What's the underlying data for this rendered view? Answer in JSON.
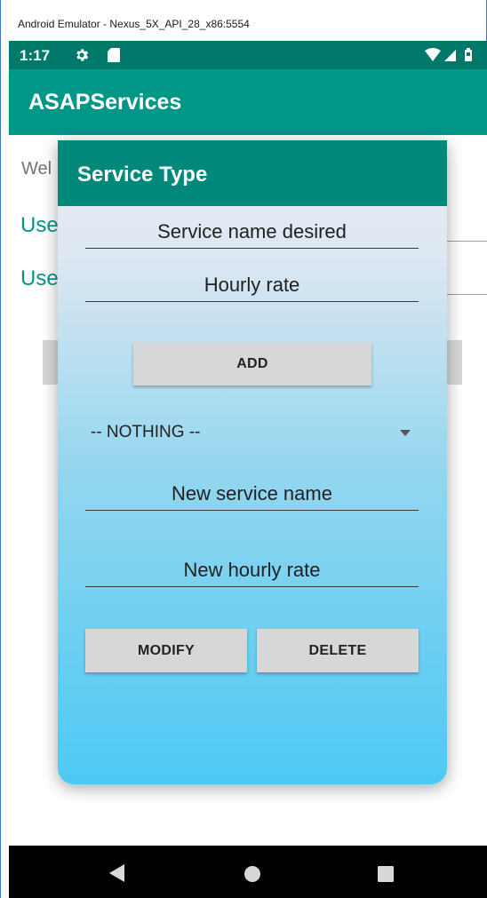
{
  "window": {
    "title": "Android Emulator - Nexus_5X_API_28_x86:5554"
  },
  "status_bar": {
    "time": "1:17",
    "icons": [
      "gear-icon",
      "sd-card-icon",
      "wifi-icon",
      "signal-icon",
      "battery-icon"
    ]
  },
  "app_bar": {
    "title": "ASAPServices"
  },
  "background": {
    "welcome_text": "Wel",
    "user_field_1": "Use",
    "user_field_2": "Use"
  },
  "dialog": {
    "title": "Service Type",
    "service_name_placeholder": "Service name desired",
    "hourly_rate_placeholder": "Hourly rate",
    "add_label": "ADD",
    "spinner_value": "-- NOTHING --",
    "new_service_name_placeholder": "New service name",
    "new_hourly_rate_placeholder": "New hourly rate",
    "modify_label": "MODIFY",
    "delete_label": "DELETE"
  },
  "colors": {
    "status_bar": "#00796b",
    "app_bar": "#009688",
    "dialog_header": "#00897b",
    "accent_text": "#009688",
    "button": "#d6d7d7"
  },
  "nav_bar": {
    "icons": [
      "back-icon",
      "home-icon",
      "recents-icon"
    ]
  }
}
